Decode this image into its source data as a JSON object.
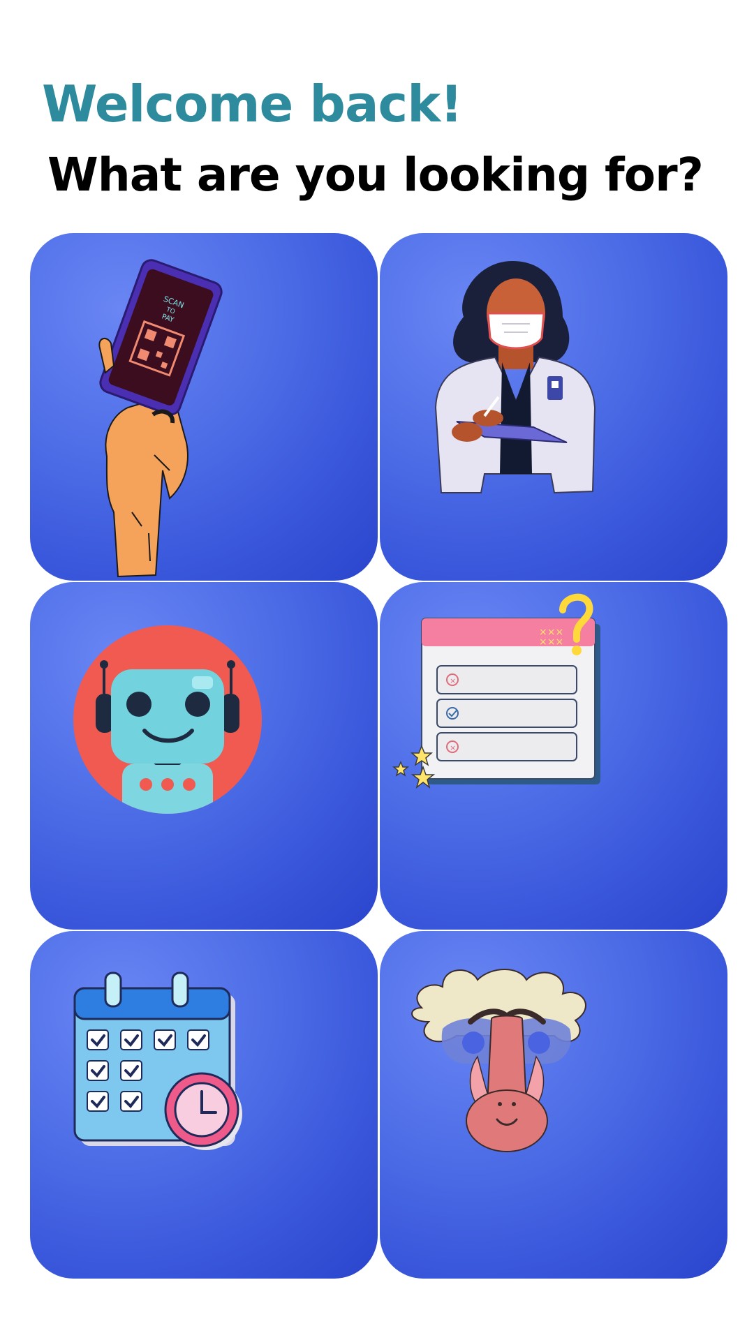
{
  "header": {
    "greeting": "Welcome back!",
    "prompt": "What are you looking for?"
  },
  "colors": {
    "greeting": "#2e8b9e",
    "prompt": "#000000",
    "tile_background": "#4f6fe8",
    "page_background": "#ffffff"
  },
  "tiles": [
    {
      "icon": "scan-to-pay-phone-icon",
      "phone_text": [
        "SCAN",
        "TO",
        "PAY"
      ]
    },
    {
      "icon": "doctor-icon"
    },
    {
      "icon": "robot-assistant-icon"
    },
    {
      "icon": "checklist-faq-icon"
    },
    {
      "icon": "calendar-clock-icon"
    },
    {
      "icon": "baboon-mask-icon"
    }
  ]
}
